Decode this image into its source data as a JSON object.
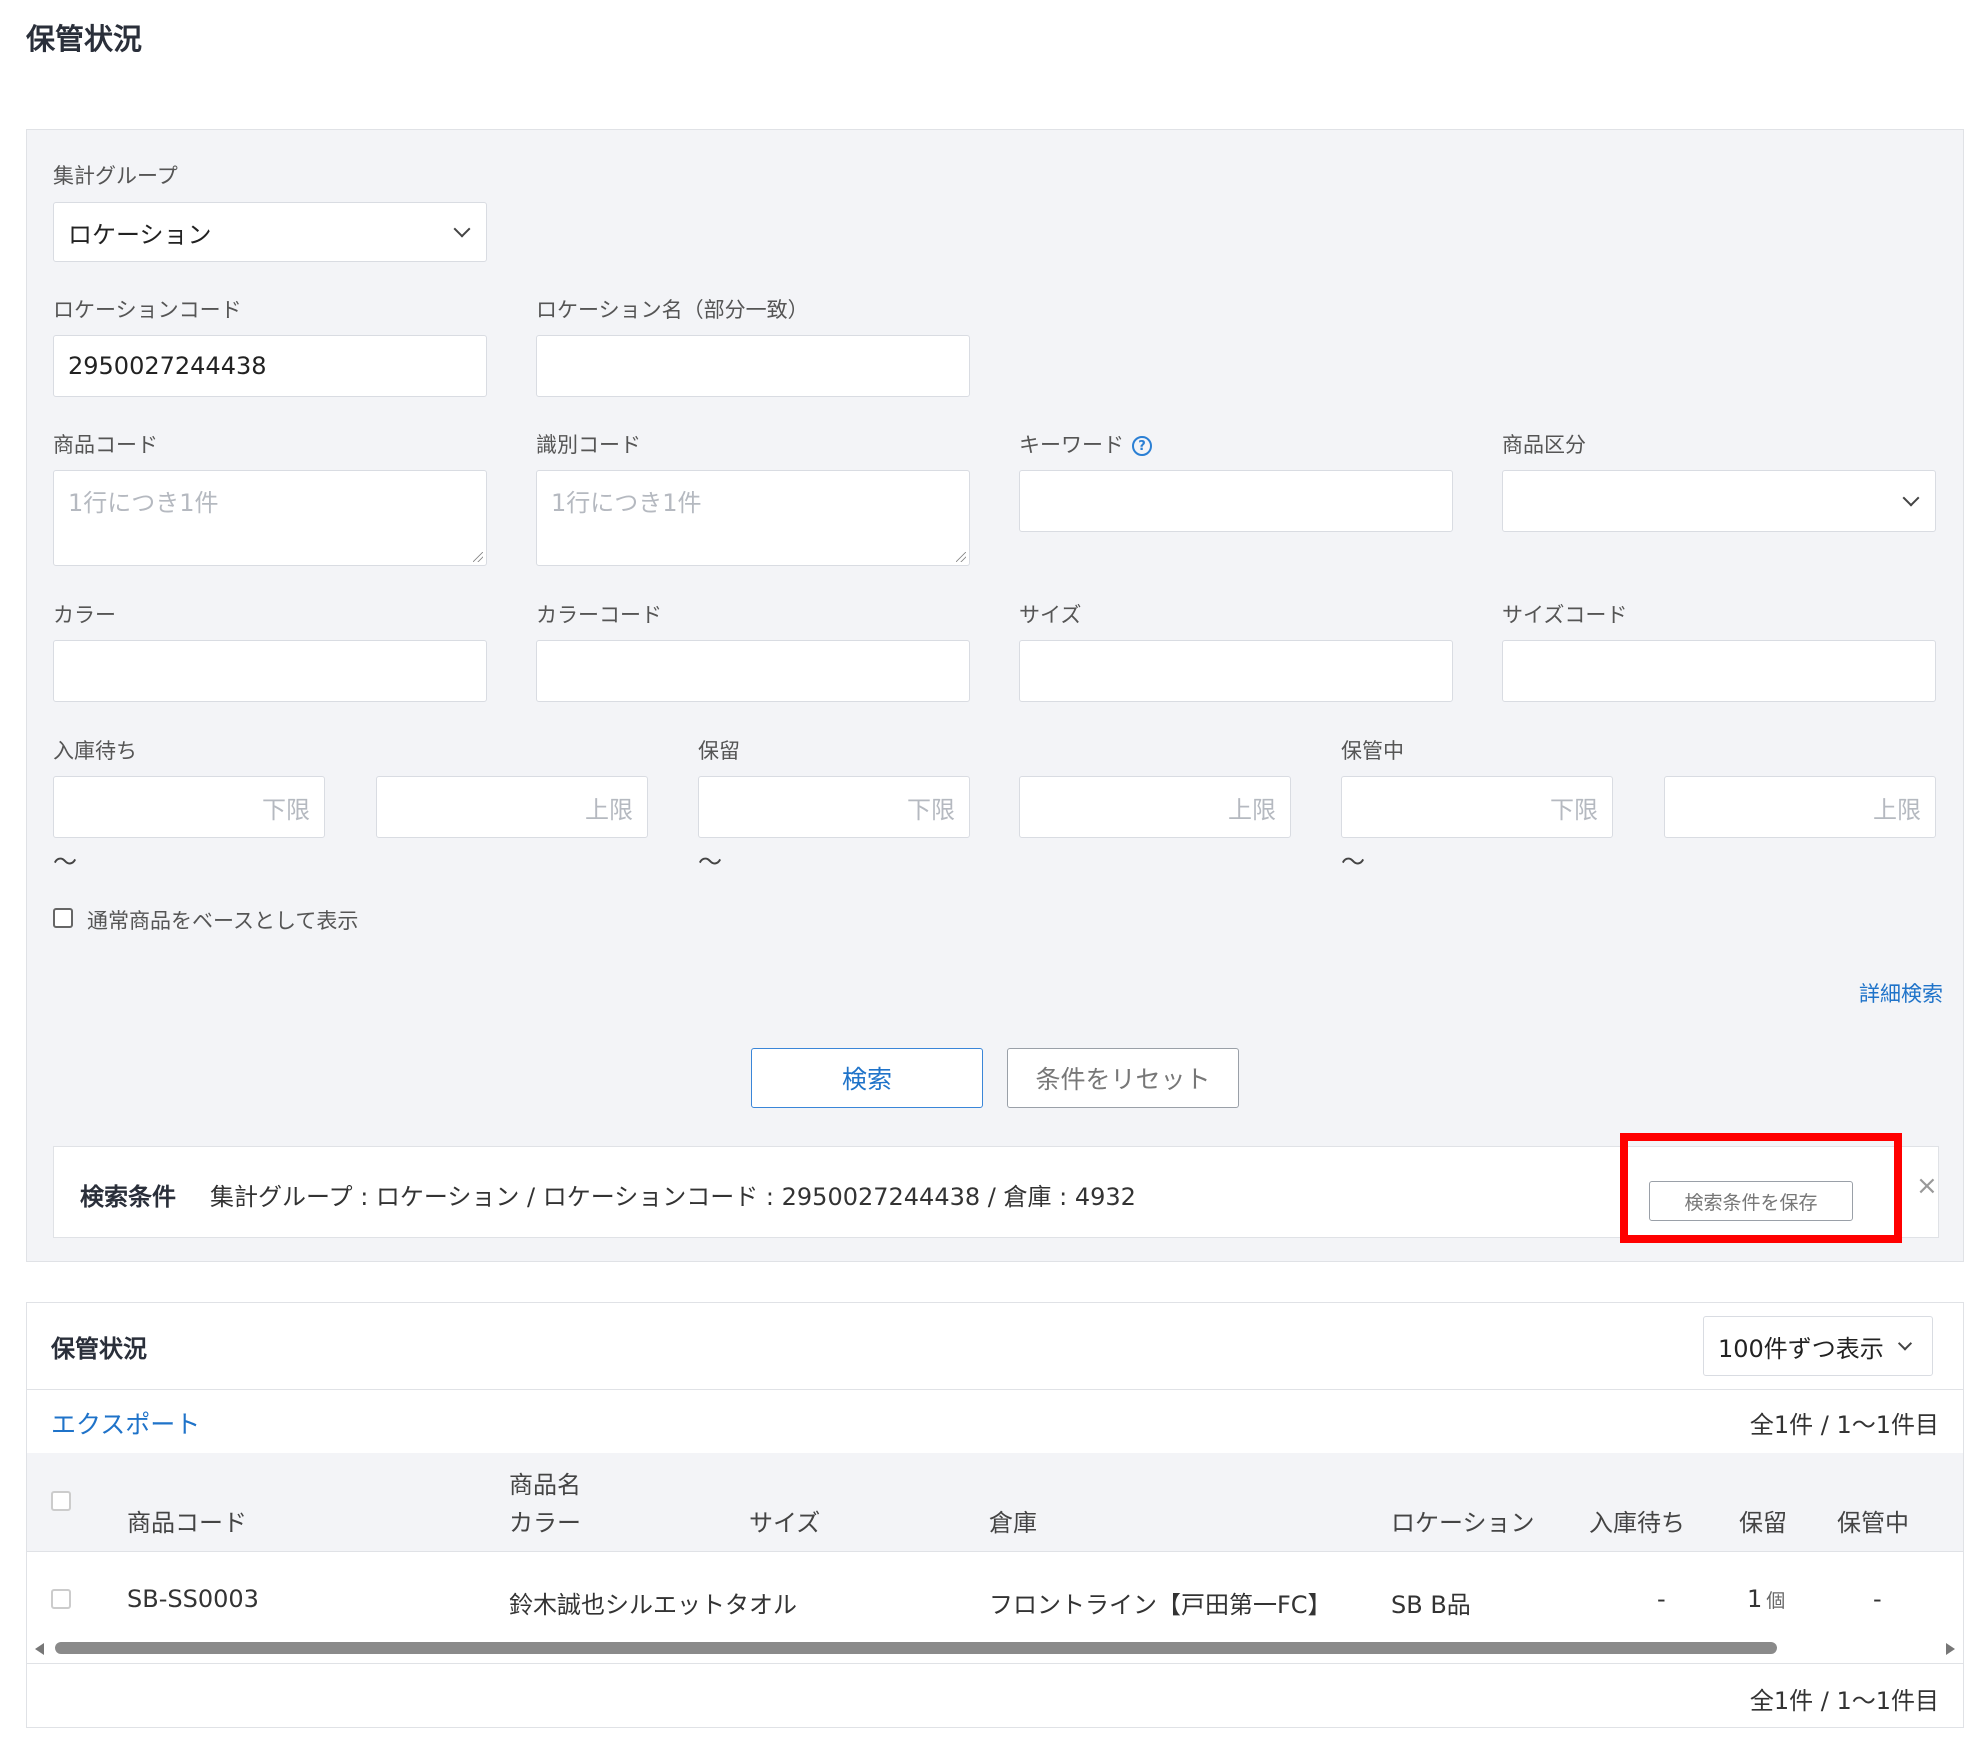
{
  "page": {
    "title": "保管状況"
  },
  "search": {
    "group_label": "集計グループ",
    "group_value": "ロケーション",
    "location_code_label": "ロケーションコード",
    "location_code_value": "2950027244438",
    "location_name_label": "ロケーション名（部分一致）",
    "location_name_value": "",
    "product_code_label": "商品コード",
    "product_code_placeholder": "1行につき1件",
    "id_code_label": "識別コード",
    "id_code_placeholder": "1行につき1件",
    "keyword_label": "キーワード",
    "keyword_help_icon": "question-circle-icon",
    "product_class_label": "商品区分",
    "product_class_value": "",
    "color_label": "カラー",
    "color_code_label": "カラーコード",
    "size_label": "サイズ",
    "size_code_label": "サイズコード",
    "pending_label": "入庫待ち",
    "hold_label": "保留",
    "storing_label": "保管中",
    "lower_placeholder": "下限",
    "upper_placeholder": "上限",
    "tilde": "～",
    "base_checkbox_label": "通常商品をベースとして表示",
    "base_checkbox_checked": false,
    "advanced_link": "詳細検索",
    "search_button": "検索",
    "reset_button": "条件をリセット"
  },
  "conditions": {
    "title": "検索条件",
    "text": "集計グループ : ロケーション / ロケーションコード : 2950027244438 / 倉庫 : 4932",
    "save_button": "検索条件を保存",
    "close_icon": "×",
    "highlight_color": "#ff0000"
  },
  "results": {
    "title": "保管状況",
    "per_page": "100件ずつ表示",
    "export_link": "エクスポート",
    "count_top": "全1件 / 1～1件目",
    "count_bottom": "全1件 / 1～1件目",
    "columns": {
      "product_code": "商品コード",
      "product_name": "商品名",
      "color": "カラー",
      "size": "サイズ",
      "warehouse": "倉庫",
      "location": "ロケーション",
      "pending": "入庫待ち",
      "hold": "保留",
      "storing": "保管中"
    },
    "rows": [
      {
        "product_code": "SB-SS0003",
        "product_name": "鈴木誠也シルエットタオル",
        "warehouse": "フロントライン【戸田第一FC】",
        "location": "SB B品",
        "pending": "-",
        "hold": "1",
        "hold_unit": "個",
        "storing": "-"
      }
    ]
  },
  "colors": {
    "accent": "#1f73c9",
    "panel_bg": "#f3f4f7"
  }
}
